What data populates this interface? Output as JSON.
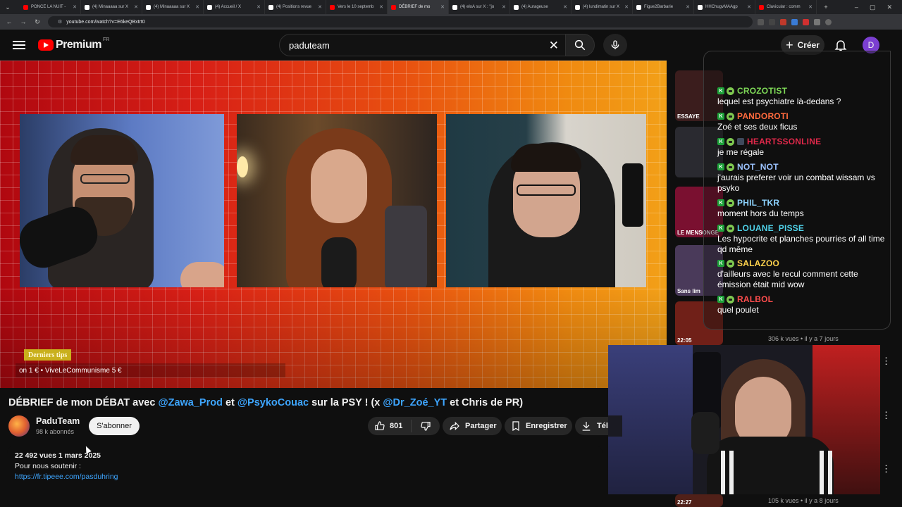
{
  "browser": {
    "tabs": [
      {
        "label": "PONCE LA NUIT -",
        "fav": "#ff0000"
      },
      {
        "label": "(4) Minaaaaa sur X",
        "fav": "#ffffff"
      },
      {
        "label": "(4) Minaaaaa sur X",
        "fav": "#ffffff"
      },
      {
        "label": "(4) Accueil / X",
        "fav": "#ffffff"
      },
      {
        "label": "(4) Positions revue",
        "fav": "#ffffff"
      },
      {
        "label": "Vers le 10 septemb",
        "fav": "#ff0000"
      },
      {
        "label": "DÉBRIEF de mo",
        "fav": "#ff0000",
        "active": true
      },
      {
        "label": "(4) eloA sur X : \"jo",
        "fav": "#ffffff"
      },
      {
        "label": "(4) Aurageuse",
        "fav": "#ffffff"
      },
      {
        "label": "(4) lundimatin sur X",
        "fav": "#ffffff"
      },
      {
        "label": "Figue2Barbarie",
        "fav": "#ffffff"
      },
      {
        "label": "HHChugvMAAgp",
        "fav": "#ffffff"
      },
      {
        "label": "Clavicular : comm",
        "fav": "#ff0000"
      }
    ],
    "url": "youtube.com/watch?v=E6keQBxtrt0"
  },
  "header": {
    "logo_word": "Premium",
    "logo_region": "FR",
    "search_value": "paduteam",
    "create_label": "Créer",
    "avatar_letter": "D"
  },
  "player": {
    "tips_title": "Derniers tips",
    "tips_ticker": "on 1 € • ViveLeCommunisme 5 €"
  },
  "chat": [
    {
      "user": "CROZOTIST",
      "color": "#7ed957",
      "text": "lequel est psychiatre là-dedans ?"
    },
    {
      "user": "PANDOROTI",
      "color": "#ff6a3d",
      "text": "Zoé et ses deux ficus"
    },
    {
      "user": "HEARTSSONLINE",
      "color": "#e0284a",
      "text": "je me régale"
    },
    {
      "user": "NOT_NOT",
      "color": "#9cc3ff",
      "text": "j'aurais preferer voir un combat wissam vs psyko"
    },
    {
      "user": "PHIL_TKR",
      "color": "#8dd3ff",
      "text": "moment hors du temps"
    },
    {
      "user": "LOUANE_PISSE",
      "color": "#4fd1e8",
      "text": "Les hypocrite et planches pourries of all time qd même"
    },
    {
      "user": "SALAZOO",
      "color": "#ffd34d",
      "text": "d'ailleurs avec le recul comment cette émission était mid wow"
    },
    {
      "user": "RALBOL",
      "color": "#ff4d4d",
      "text": "quel poulet"
    }
  ],
  "recommendations": [
    {
      "thumb_label": "ESSAYE",
      "meta": ""
    },
    {
      "thumb_label": "",
      "meta": ""
    },
    {
      "thumb_label": "LE MENSONGE",
      "meta": ""
    },
    {
      "thumb_label": "Sans lim",
      "meta": ""
    },
    {
      "thumb_label": "22:05",
      "meta": "306 k vues • il y a 7 jours"
    },
    {
      "thumb_label": "22:27",
      "meta": "105 k vues • il y a 8 jours"
    }
  ],
  "video": {
    "title_parts": [
      {
        "text": "DÉBRIEF de mon DÉBAT avec ",
        "link": false
      },
      {
        "text": "@Zawa_Prod",
        "link": true
      },
      {
        "text": " et ",
        "link": false
      },
      {
        "text": "@PsykoCouac",
        "link": true
      },
      {
        "text": " sur la PSY ! (x ",
        "link": false
      },
      {
        "text": "@Dr_Zoé_YT",
        "link": true
      },
      {
        "text": " et Chris de PR)",
        "link": false
      }
    ],
    "channel_name": "PaduTeam",
    "channel_subs": "98 k abonnés",
    "subscribe_label": "S'abonner",
    "likes": "801",
    "share_label": "Partager",
    "save_label": "Enregistrer",
    "download_label": "Télé",
    "stats": "22 492 vues  1 mars 2025",
    "desc_line1": "Pour nous soutenir :",
    "desc_link": "https://fr.tipeee.com/pasduhring"
  }
}
